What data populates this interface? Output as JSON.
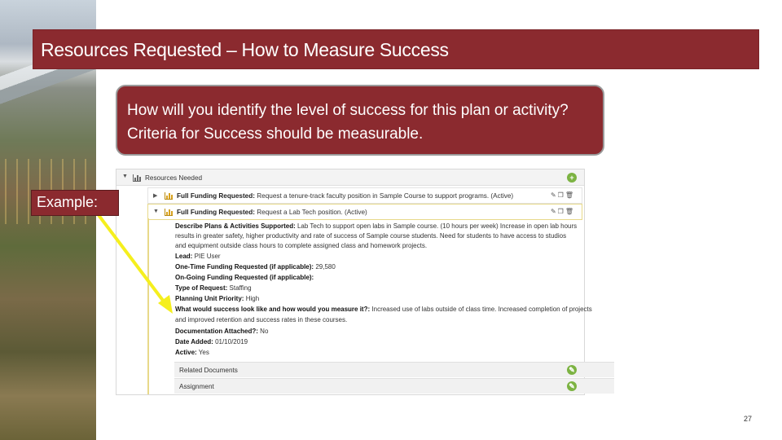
{
  "title": {
    "bold": "Resources Requested",
    "separator": " – ",
    "rest": "How to Measure Success"
  },
  "callout": {
    "text": "How will you identify the level of success for this plan or activity? Criteria for Success should be measurable."
  },
  "example_label": "Example:",
  "screenshot": {
    "section_title": "Resources Needed",
    "rows": [
      {
        "prefix": "Full Funding Requested:",
        "text": "Request a tenure-track faculty position in Sample Course to support programs. (Active)"
      },
      {
        "prefix": "Full Funding Requested:",
        "text": "Request a Lab Tech position. (Active)"
      }
    ],
    "details": [
      {
        "label": "Describe Plans & Activities Supported:",
        "value": "Lab Tech to support open labs in Sample course. (10 hours per week) Increase in open lab hours"
      },
      {
        "label": "",
        "value": "results in greater safety, higher productivity and rate of success of Sample course students. Need for students to have access to studios"
      },
      {
        "label": "",
        "value": "and equipment outside class hours to complete assigned class and homework projects."
      },
      {
        "label": "Lead:",
        "value": "PIE User"
      },
      {
        "label": "One-Time Funding Requested (if applicable):",
        "value": "29,580"
      },
      {
        "label": "On-Going Funding Requested (if applicable):",
        "value": ""
      },
      {
        "label": "Type of Request:",
        "value": "Staffing"
      },
      {
        "label": "Planning Unit Priority:",
        "value": "High"
      },
      {
        "label": "What would success look like and how would you measure it?:",
        "value": "Increased use of labs outside of class time. Increased completion of projects"
      },
      {
        "label": "",
        "value": "and improved retention and success rates in these courses."
      },
      {
        "label": "Documentation Attached?:",
        "value": "No"
      },
      {
        "label": "Date Added:",
        "value": "01/10/2019"
      },
      {
        "label": "Active:",
        "value": "Yes"
      }
    ],
    "subsections": [
      "Related Documents",
      "Assignment"
    ]
  },
  "page_number": "27",
  "colors": {
    "accent": "#8b2a2f",
    "arrow": "#f5ef1e",
    "highlight_border": "#e8d98a",
    "add_button": "#7cb342"
  },
  "icons": [
    "bar-chart-icon",
    "caret-right-icon",
    "caret-down-icon",
    "plus-icon",
    "edit-icon",
    "copy-icon",
    "delete-icon",
    "arrow-icon"
  ]
}
